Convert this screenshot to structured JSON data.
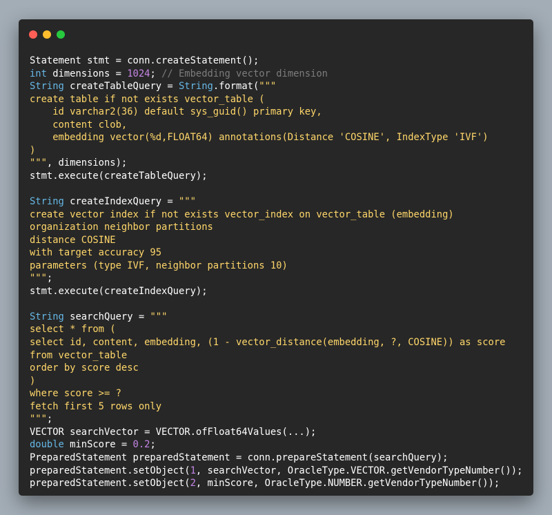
{
  "window": {
    "buttons": [
      {
        "name": "close-button",
        "color": "#ff5f56"
      },
      {
        "name": "minimize-button",
        "color": "#ffbd2e"
      },
      {
        "name": "maximize-button",
        "color": "#27c93f"
      }
    ]
  },
  "colors": {
    "plain": "#ffffff",
    "keyword": "#66b8e6",
    "number": "#c586e6",
    "comment": "#7c7c7c",
    "string": "#ffd76a"
  },
  "lines": [
    [
      [
        "plain",
        "Statement stmt = conn.createStatement();"
      ]
    ],
    [
      [
        "keyword",
        "int"
      ],
      [
        "plain",
        " dimensions = "
      ],
      [
        "number",
        "1024"
      ],
      [
        "plain",
        "; "
      ],
      [
        "comment",
        "// Embedding vector dimension"
      ]
    ],
    [
      [
        "keyword",
        "String"
      ],
      [
        "plain",
        " createTableQuery = "
      ],
      [
        "keyword",
        "String"
      ],
      [
        "plain",
        ".format("
      ],
      [
        "string",
        "\"\"\""
      ]
    ],
    [
      [
        "string",
        "create table if not exists vector_table ("
      ]
    ],
    [
      [
        "string",
        "    id varchar2(36) default sys_guid() primary key,"
      ]
    ],
    [
      [
        "string",
        "    content clob,"
      ]
    ],
    [
      [
        "string",
        "    embedding vector(%d,FLOAT64) annotations(Distance 'COSINE', IndexType 'IVF')"
      ]
    ],
    [
      [
        "string",
        ")"
      ]
    ],
    [
      [
        "string",
        "\"\"\""
      ],
      [
        "plain",
        ", dimensions);"
      ]
    ],
    [
      [
        "plain",
        "stmt.execute(createTableQuery);"
      ]
    ],
    [
      [
        "plain",
        ""
      ]
    ],
    [
      [
        "keyword",
        "String"
      ],
      [
        "plain",
        " createIndexQuery = "
      ],
      [
        "string",
        "\"\"\""
      ]
    ],
    [
      [
        "string",
        "create vector index if not exists vector_index on vector_table (embedding)"
      ]
    ],
    [
      [
        "string",
        "organization neighbor partitions"
      ]
    ],
    [
      [
        "string",
        "distance COSINE"
      ]
    ],
    [
      [
        "string",
        "with target accuracy 95"
      ]
    ],
    [
      [
        "string",
        "parameters (type IVF, neighbor partitions 10)"
      ]
    ],
    [
      [
        "string",
        "\"\"\""
      ],
      [
        "plain",
        ";"
      ]
    ],
    [
      [
        "plain",
        "stmt.execute(createIndexQuery);"
      ]
    ],
    [
      [
        "plain",
        ""
      ]
    ],
    [
      [
        "keyword",
        "String"
      ],
      [
        "plain",
        " searchQuery = "
      ],
      [
        "string",
        "\"\"\""
      ]
    ],
    [
      [
        "string",
        "select * from ("
      ]
    ],
    [
      [
        "string",
        "select id, content, embedding, (1 - vector_distance(embedding, ?, COSINE)) as score"
      ]
    ],
    [
      [
        "string",
        "from vector_table"
      ]
    ],
    [
      [
        "string",
        "order by score desc"
      ]
    ],
    [
      [
        "string",
        ")"
      ]
    ],
    [
      [
        "string",
        "where score >= ?"
      ]
    ],
    [
      [
        "string",
        "fetch first 5 rows only"
      ]
    ],
    [
      [
        "string",
        "\"\"\""
      ],
      [
        "plain",
        ";"
      ]
    ],
    [
      [
        "plain",
        "VECTOR searchVector = VECTOR.ofFloat64Values(...);"
      ]
    ],
    [
      [
        "keyword",
        "double"
      ],
      [
        "plain",
        " minScore = "
      ],
      [
        "number",
        "0.2"
      ],
      [
        "plain",
        ";"
      ]
    ],
    [
      [
        "plain",
        "PreparedStatement preparedStatement = conn.prepareStatement(searchQuery);"
      ]
    ],
    [
      [
        "plain",
        "preparedStatement.setObject("
      ],
      [
        "number",
        "1"
      ],
      [
        "plain",
        ", searchVector, OracleType.VECTOR.getVendorTypeNumber());"
      ]
    ],
    [
      [
        "plain",
        "preparedStatement.setObject("
      ],
      [
        "number",
        "2"
      ],
      [
        "plain",
        ", minScore, OracleType.NUMBER.getVendorTypeNumber());"
      ]
    ]
  ]
}
